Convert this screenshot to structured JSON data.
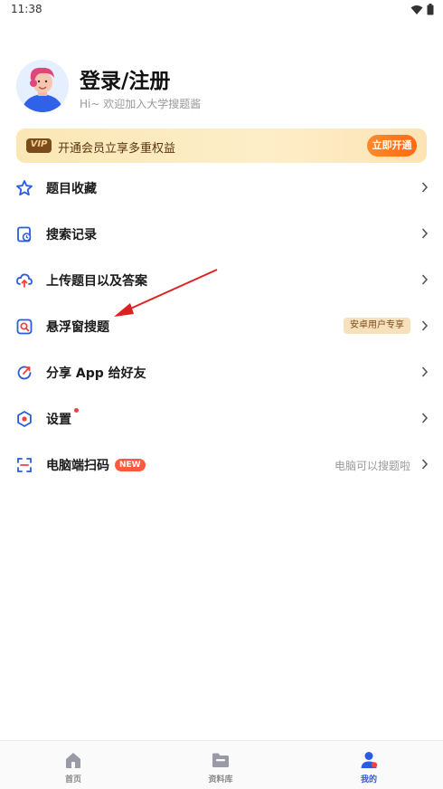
{
  "status_bar": {
    "time": "11:38"
  },
  "profile": {
    "name": "登录/注册",
    "subtitle": "Hi~ 欢迎加入大学搜题酱"
  },
  "vip": {
    "badge": "VIP",
    "text": "开通会员立享多重权益",
    "button": "立即开通"
  },
  "menu": {
    "items": [
      {
        "label": "题目收藏",
        "icon": "star-icon"
      },
      {
        "label": "搜索记录",
        "icon": "history-icon"
      },
      {
        "label": "上传题目以及答案",
        "icon": "upload-icon"
      },
      {
        "label": "悬浮窗搜题",
        "icon": "floating-search-icon",
        "tag": "安卓用户专享"
      },
      {
        "label": "分享 App 给好友",
        "icon": "share-icon"
      },
      {
        "label": "设置",
        "icon": "settings-icon"
      },
      {
        "label": "电脑端扫码",
        "icon": "scan-icon",
        "badge": "NEW",
        "trail": "电脑可以搜题啦"
      }
    ]
  },
  "bottom_nav": {
    "items": [
      {
        "label": "首页",
        "icon": "home-icon"
      },
      {
        "label": "资料库",
        "icon": "folder-icon"
      },
      {
        "label": "我的",
        "icon": "user-icon",
        "active": true
      }
    ]
  },
  "colors": {
    "accent": "#2a5be3",
    "vip_orange": "#ff6a13",
    "annotation_red": "#e02020"
  }
}
